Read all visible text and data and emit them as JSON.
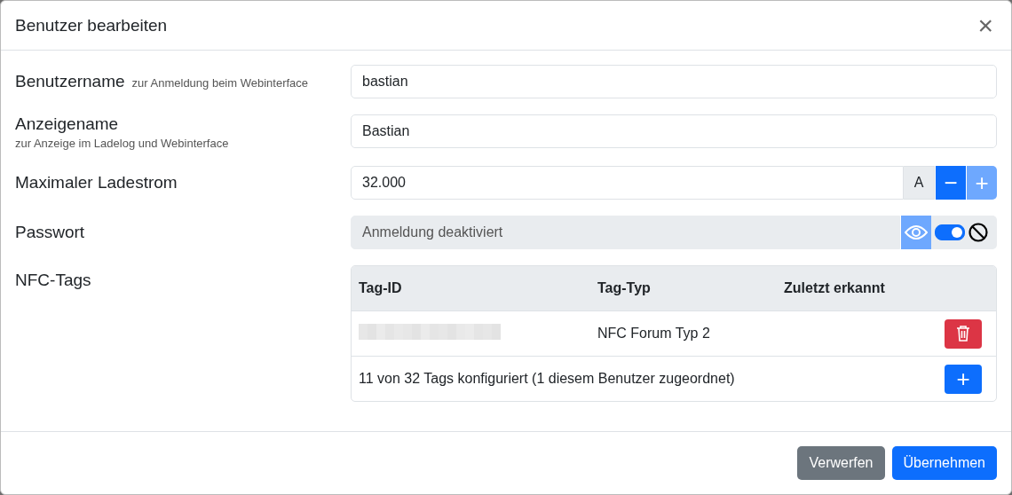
{
  "dialog": {
    "title": "Benutzer bearbeiten",
    "close": "×"
  },
  "fields": [
    {
      "kind": "text",
      "label": "Benutzername",
      "hint": "zur Anmeldung beim Webinterface",
      "hint_below": false,
      "value": "bastian"
    },
    {
      "kind": "text",
      "label": "Anzeigename",
      "hint": "zur Anzeige im Ladelog und Webinterface",
      "hint_below": true,
      "value": "Bastian"
    },
    {
      "kind": "number",
      "label": "Maximaler Ladestrom",
      "value": "32.000",
      "unit": "A",
      "minus": {
        "label": "−",
        "disabled": false
      },
      "plus": {
        "label": "+",
        "disabled": true
      }
    },
    {
      "kind": "password",
      "label": "Passwort",
      "placeholder": "Anmeldung deaktiviert",
      "reveal_disabled": true,
      "on": true
    }
  ],
  "nfc": {
    "label": "NFC-Tags",
    "columns": [
      "Tag-ID",
      "Tag-Typ",
      "Zuletzt erkannt"
    ],
    "rows": [
      {
        "tag_id": {
          "kind": "redacted"
        },
        "tag_type": "NFC Forum Typ 2",
        "last_seen": ""
      }
    ],
    "summary": "11 von 32 Tags konfiguriert (1 diesem Benutzer zugeordnet)",
    "add": "+"
  },
  "buttons": [
    {
      "label": "Verwerfen",
      "kind": "secondary"
    },
    {
      "label": "Übernehmen",
      "kind": "primary"
    }
  ]
}
